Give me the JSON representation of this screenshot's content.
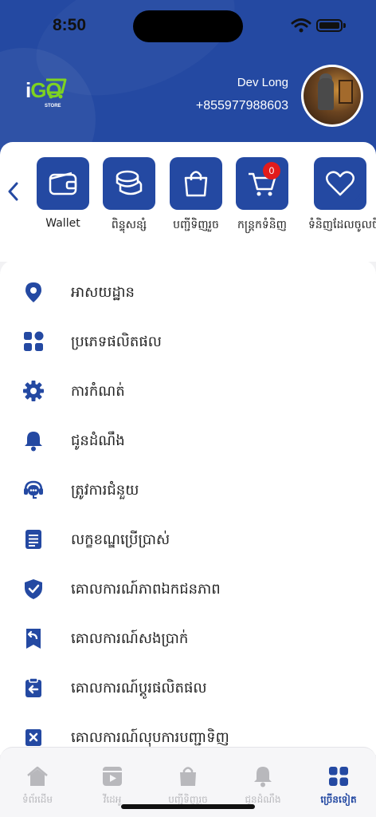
{
  "status_bar": {
    "time": "8:50"
  },
  "brand": {
    "logo_text_i": "i",
    "logo_text_go": "GO",
    "logo_sub": "STORE",
    "primary_color": "#2449a2",
    "accent_color": "#7ed321"
  },
  "user": {
    "name": "Dev Long",
    "phone": "+855977988603",
    "avatar_icon": "avatar-image"
  },
  "quick_actions": {
    "items": [
      {
        "label": "Wallet",
        "icon": "wallet-icon"
      },
      {
        "label": "ពិន្ទុសន្សំ",
        "icon": "coins-icon"
      },
      {
        "label": "បញ្ជីទិញរួច",
        "icon": "shopping-bag-icon"
      },
      {
        "label": "កន្ត្រកទំនិញ",
        "icon": "cart-icon",
        "badge": "0"
      },
      {
        "label": "ទំនិញដែលចូលចិត្ត",
        "icon": "heart-icon"
      }
    ]
  },
  "menu": {
    "items": [
      {
        "label": "អាសយដ្ឋាន",
        "icon": "location-pin-icon"
      },
      {
        "label": "ប្រភេទផលិតផល",
        "icon": "categories-icon"
      },
      {
        "label": "ការកំណត់",
        "icon": "gear-icon"
      },
      {
        "label": "ជូនដំណឹង",
        "icon": "bell-icon"
      },
      {
        "label": "ត្រូវការជំនួយ",
        "icon": "support-chat-icon"
      },
      {
        "label": "លក្ខខណ្ឌប្រើប្រាស់",
        "icon": "document-icon"
      },
      {
        "label": "គោលការណ៍ភាពឯកជនភាព",
        "icon": "shield-check-icon"
      },
      {
        "label": "គោលការណ៍សងប្រាក់",
        "icon": "refund-icon"
      },
      {
        "label": "គោលការណ៍ប្តូរផលិតផល",
        "icon": "exchange-icon"
      },
      {
        "label": "គោលការណ៍លុបការបញ្ជាទិញ",
        "icon": "cancel-order-icon"
      }
    ]
  },
  "tabbar": {
    "items": [
      {
        "label": "ទំព័រដើម",
        "icon": "home-icon",
        "active": false
      },
      {
        "label": "វីដេអូ",
        "icon": "video-icon",
        "active": false
      },
      {
        "label": "បញ្ជីទិញរួច",
        "icon": "shopping-bag-icon",
        "active": false
      },
      {
        "label": "ជូនដំណឹង",
        "icon": "bell-icon",
        "active": false
      },
      {
        "label": "ច្រើនទៀត",
        "icon": "more-grid-icon",
        "active": true
      }
    ]
  }
}
